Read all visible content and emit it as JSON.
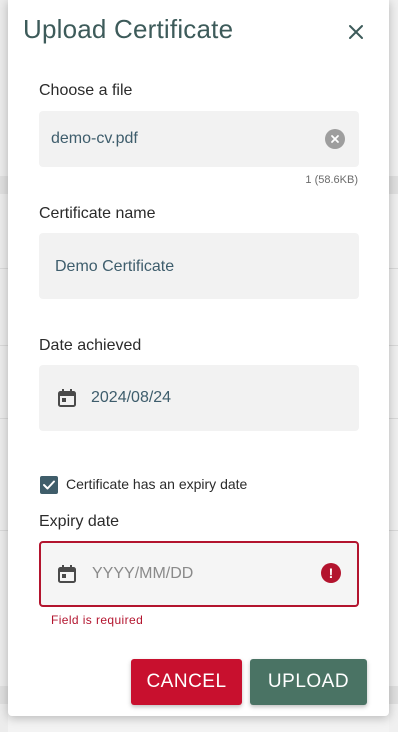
{
  "modal": {
    "title": "Upload Certificate",
    "close_icon": "close-icon"
  },
  "file": {
    "label": "Choose a file",
    "value": "demo-cv.pdf",
    "clear_icon": "clear-circle-icon",
    "hint": "1 (58.6KB)"
  },
  "name": {
    "label": "Certificate name",
    "value": "Demo Certificate"
  },
  "date_achieved": {
    "label": "Date achieved",
    "value": "2024/08/24",
    "icon": "calendar-icon"
  },
  "expiry_toggle": {
    "label": "Certificate has an expiry date",
    "checked": true
  },
  "expiry": {
    "label": "Expiry date",
    "placeholder": "YYYY/MM/DD",
    "icon": "calendar-icon",
    "error_icon": "error-circle-icon",
    "error_text": "Field is required"
  },
  "actions": {
    "cancel_label": "CANCEL",
    "upload_label": "UPLOAD"
  },
  "colors": {
    "title": "#3d5b5a",
    "error": "#b3142e",
    "cancel": "#c8102e",
    "upload": "#4a7364",
    "checkbox": "#3f5d6a"
  }
}
